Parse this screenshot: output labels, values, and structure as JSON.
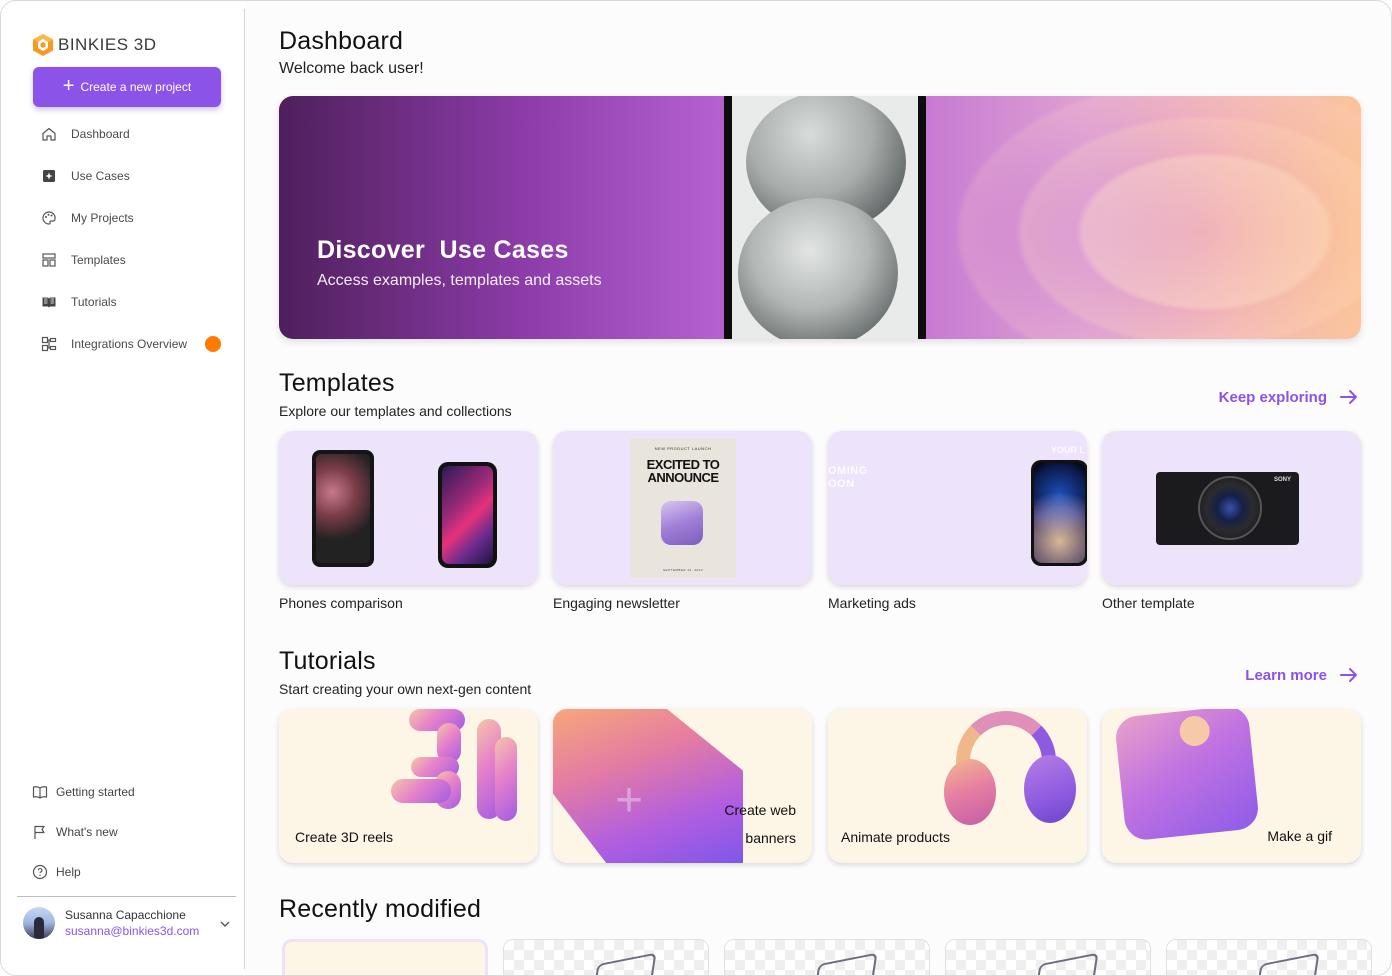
{
  "app": {
    "logo_text": "BINKIES 3D",
    "accent_color": "#8c53e8",
    "notification_color": "#ff7a00"
  },
  "sidebar": {
    "create_button_label": "Create a new project",
    "items": [
      {
        "label": "Dashboard",
        "icon": "home-icon"
      },
      {
        "label": "Use Cases",
        "icon": "sparkle-box-icon"
      },
      {
        "label": "My Projects",
        "icon": "palette-icon"
      },
      {
        "label": "Templates",
        "icon": "layout-icon"
      },
      {
        "label": "Tutorials",
        "icon": "book-icon"
      },
      {
        "label": "Integrations Overview",
        "icon": "integrations-icon"
      }
    ],
    "bottom_items": [
      {
        "label": "Getting started",
        "icon": "open-book-icon"
      },
      {
        "label": "What's new",
        "icon": "flag-icon"
      },
      {
        "label": "Help",
        "icon": "help-circle-icon"
      }
    ],
    "user": {
      "name": "Susanna Capacchione",
      "email": "susanna@binkies3d.com"
    }
  },
  "header": {
    "title": "Dashboard",
    "subtitle": "Welcome back user!"
  },
  "hero": {
    "title": "Discover  Use Cases",
    "subtitle": "Access examples, templates and assets"
  },
  "templates": {
    "title": "Templates",
    "subtitle": "Explore our templates and collections",
    "link_label": "Keep exploring",
    "cards": [
      {
        "caption": "Phones comparison"
      },
      {
        "caption": "Engaging newsletter",
        "poster_top": "NEW PRODUCT LAUNCH",
        "poster_headline": "EXCITED TO ANNOUNCE",
        "poster_bottom": "SEPTEMBER 12, 2023"
      },
      {
        "caption": "Marketing ads",
        "overlay_text": "OMING OON",
        "corner_text": "YOUR L"
      },
      {
        "caption": "Other template",
        "brand_text": "SONY"
      }
    ]
  },
  "tutorials": {
    "title": "Tutorials",
    "subtitle": "Start creating your own next-gen content",
    "link_label": "Learn more",
    "cards": [
      {
        "label": "Create 3D reels"
      },
      {
        "label_line1": "Create web",
        "label_line2": "banners"
      },
      {
        "label": "Animate products"
      },
      {
        "label": "Make a gif"
      }
    ]
  },
  "recent": {
    "title": "Recently modified"
  }
}
